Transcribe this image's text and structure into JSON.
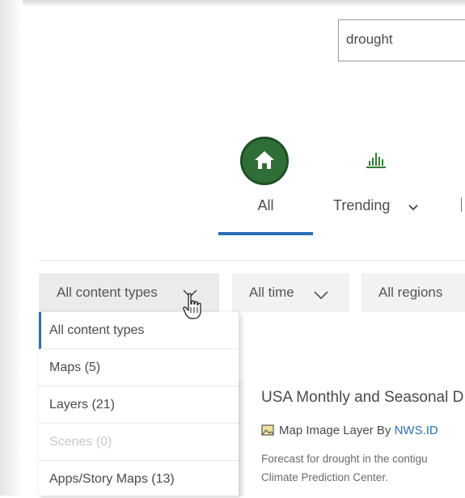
{
  "search": {
    "value": "drought"
  },
  "tabs": [
    {
      "label": "All",
      "icon": "home-icon",
      "selected": true
    },
    {
      "label": "Trending",
      "icon": "trending-chart-icon",
      "has_dropdown": true
    }
  ],
  "filters": {
    "content_types": "All content types",
    "time": "All time",
    "regions": "All regions"
  },
  "dropdown": {
    "items": [
      {
        "label": "All content types",
        "selected": true
      },
      {
        "label": "Maps (5)"
      },
      {
        "label": "Layers (21)"
      },
      {
        "label": "Scenes (0)",
        "disabled": true
      },
      {
        "label": "Apps/Story Maps (13)"
      }
    ]
  },
  "result": {
    "title": "USA Monthly and Seasonal D",
    "type": "Map Image Layer",
    "by": "By",
    "owner": "NWS.ID",
    "description_lines": [
      "Forecast for drought in the contigu",
      "Climate Prediction Center."
    ]
  },
  "colors": {
    "accent": "#2b6fb5",
    "home_circle": "#2f6f37",
    "trending_icon": "#2e7d32"
  }
}
